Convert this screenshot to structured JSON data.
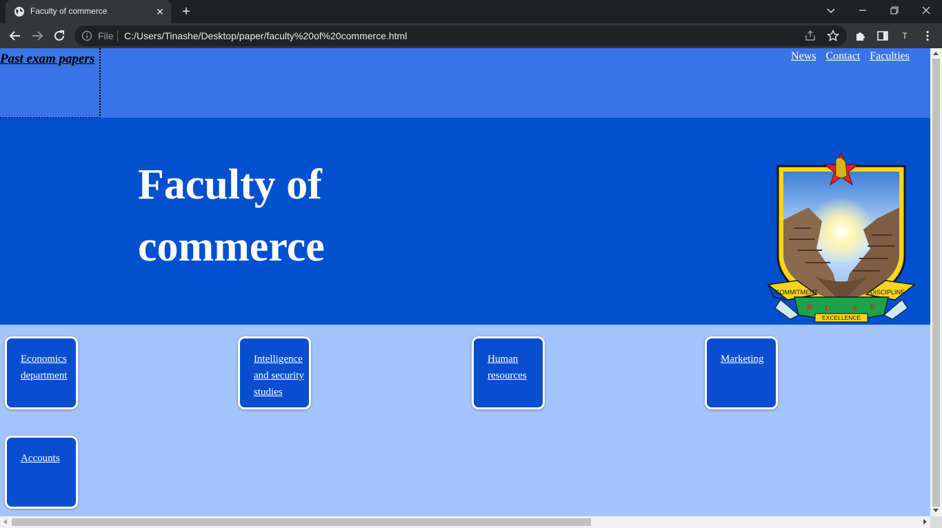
{
  "browser": {
    "tab_title": "Faculty of commerce",
    "file_label": "File",
    "url": "C:/Users/Tinashe/Desktop/paper/faculty%20of%20commerce.html",
    "profile_initial": "T"
  },
  "page": {
    "past_papers_link": "Past exam papers",
    "nav": [
      "News",
      "Contact",
      "Faculties"
    ],
    "hero_title": "Faculty of commerce",
    "crest": {
      "motto_left": "COMMITMENT",
      "motto_right": "DISCIPLINE",
      "motto_bottom": "EXCELLENCE",
      "letters": [
        "B",
        "U",
        "S",
        "E"
      ]
    },
    "departments": [
      "Economics department",
      "Intelligence and security studies",
      "Human resources",
      "Marketing",
      "Accounts"
    ]
  },
  "colors": {
    "header": "#3874e6",
    "hero": "#0050d0",
    "body": "#a4c3fa",
    "card": "#0a4ed0"
  }
}
